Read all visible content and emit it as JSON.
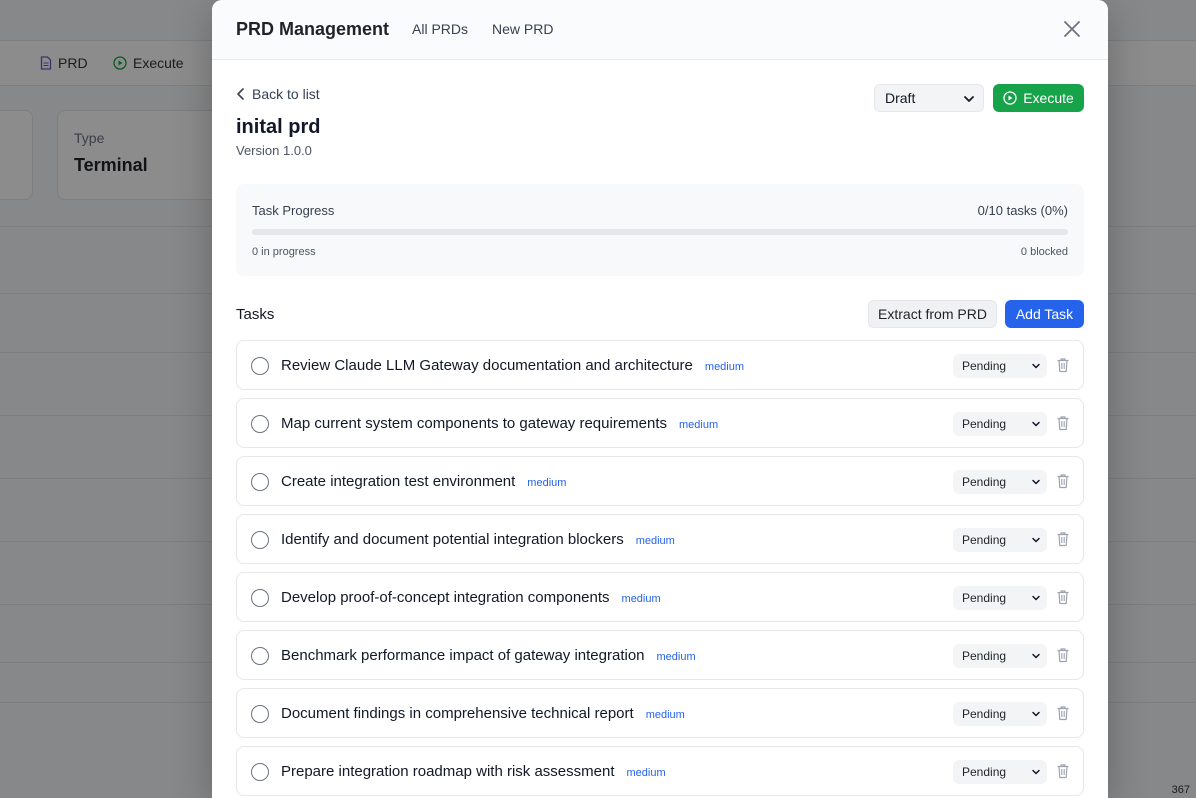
{
  "background": {
    "toolbar": [
      {
        "label": "PRD",
        "icon": "document-icon"
      },
      {
        "label": "Execute",
        "icon": "play-circle-icon"
      }
    ],
    "type_label": "Type",
    "type_value": "Terminal",
    "corner_text": "367"
  },
  "modal": {
    "title": "PRD Management",
    "tabs": [
      "All PRDs",
      "New PRD"
    ]
  },
  "detail": {
    "back_label": "Back to list",
    "name": "inital prd",
    "version": "Version 1.0.0",
    "status": "Draft",
    "execute_label": "Execute"
  },
  "progress": {
    "title": "Task Progress",
    "count": "0/10 tasks (0%)",
    "percent": 0,
    "in_progress": "0 in progress",
    "blocked": "0 blocked"
  },
  "tasks_section": {
    "heading": "Tasks",
    "extract_label": "Extract from PRD",
    "add_label": "Add Task"
  },
  "tasks": [
    {
      "title": "Review Claude LLM Gateway documentation and architecture",
      "priority": "medium",
      "status": "Pending"
    },
    {
      "title": "Map current system components to gateway requirements",
      "priority": "medium",
      "status": "Pending"
    },
    {
      "title": "Create integration test environment",
      "priority": "medium",
      "status": "Pending"
    },
    {
      "title": "Identify and document potential integration blockers",
      "priority": "medium",
      "status": "Pending"
    },
    {
      "title": "Develop proof-of-concept integration components",
      "priority": "medium",
      "status": "Pending"
    },
    {
      "title": "Benchmark performance impact of gateway integration",
      "priority": "medium",
      "status": "Pending"
    },
    {
      "title": "Document findings in comprehensive technical report",
      "priority": "medium",
      "status": "Pending"
    },
    {
      "title": "Prepare integration roadmap with risk assessment",
      "priority": "medium",
      "status": "Pending"
    }
  ],
  "colors": {
    "primary": "#2563eb",
    "success": "#16a34a",
    "priority_medium": "#2563eb"
  }
}
